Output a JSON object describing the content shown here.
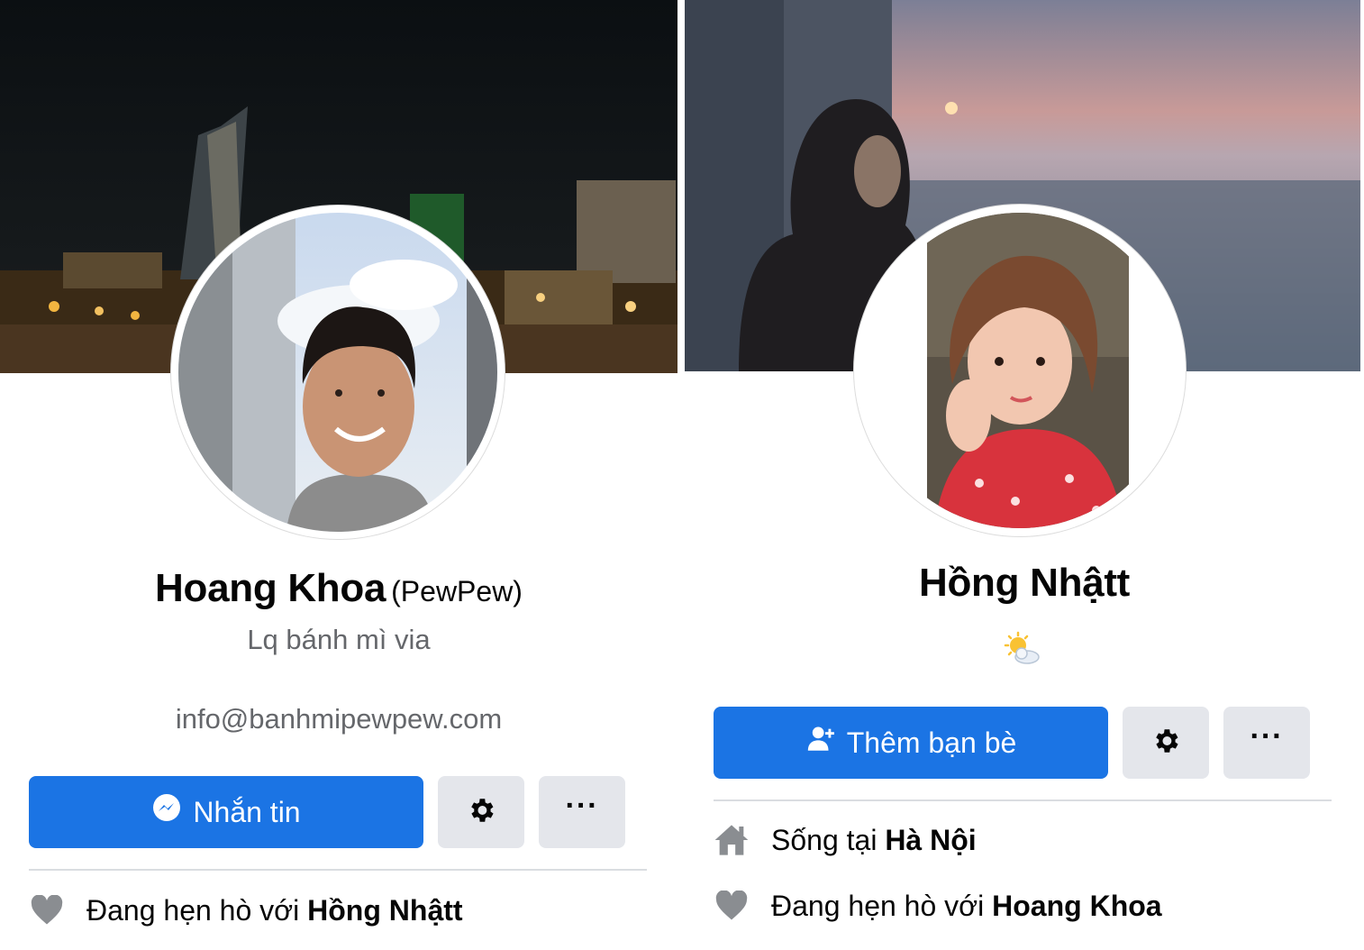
{
  "left_profile": {
    "name": "Hoang Khoa",
    "alternate_name": "(PewPew)",
    "bio": "Lq bánh mì via",
    "email": "info@banhmipewpew.com",
    "actions": {
      "primary_label": "Nhắn tin",
      "primary_icon": "messenger-icon",
      "settings_icon": "gear-icon",
      "more_label": "···"
    },
    "relationship": {
      "icon": "heart-icon",
      "prefix": "Đang hẹn hò với ",
      "partner": "Hồng Nhậtt"
    }
  },
  "right_profile": {
    "name": "Hồng Nhậtt",
    "status_emoji": "sun-behind-cloud-icon",
    "actions": {
      "primary_label": "Thêm bạn bè",
      "primary_icon": "add-friend-icon",
      "settings_icon": "gear-icon",
      "more_label": "···"
    },
    "lives_in": {
      "icon": "home-icon",
      "prefix": "Sống tại ",
      "place": "Hà Nội"
    },
    "relationship": {
      "icon": "heart-icon",
      "prefix": "Đang hẹn hò với ",
      "partner": "Hoang Khoa"
    }
  },
  "colors": {
    "primary_button": "#1b74e4",
    "secondary_button": "#e4e6eb",
    "secondary_text": "#65676b",
    "icon_gray": "#8a8d91"
  }
}
